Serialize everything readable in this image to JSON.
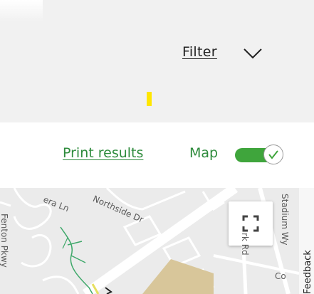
{
  "filter": {
    "label": "Filter",
    "chevron_icon": "chevron-down-icon"
  },
  "results_bar": {
    "print_label": "Print results",
    "map_label": "Map",
    "map_toggle_on": true,
    "toggle_icon": "check-icon"
  },
  "map": {
    "street_labels": {
      "era_ln": "era Ln",
      "northside_dr": "Northside Dr",
      "fenton_pkwy": "Fenton Pkwy",
      "stadium_wy": "Stadium Wy",
      "rk_rd": "rk Rd",
      "co": "Co"
    },
    "fullscreen_icon": "fullscreen-icon"
  },
  "feedback": {
    "label": "Feedback"
  },
  "colors": {
    "accent_green": "#2e8b3c",
    "toggle_green": "#3fa53c",
    "marker_yellow": "#ffe600",
    "filter_bg": "#f1f1f1"
  }
}
